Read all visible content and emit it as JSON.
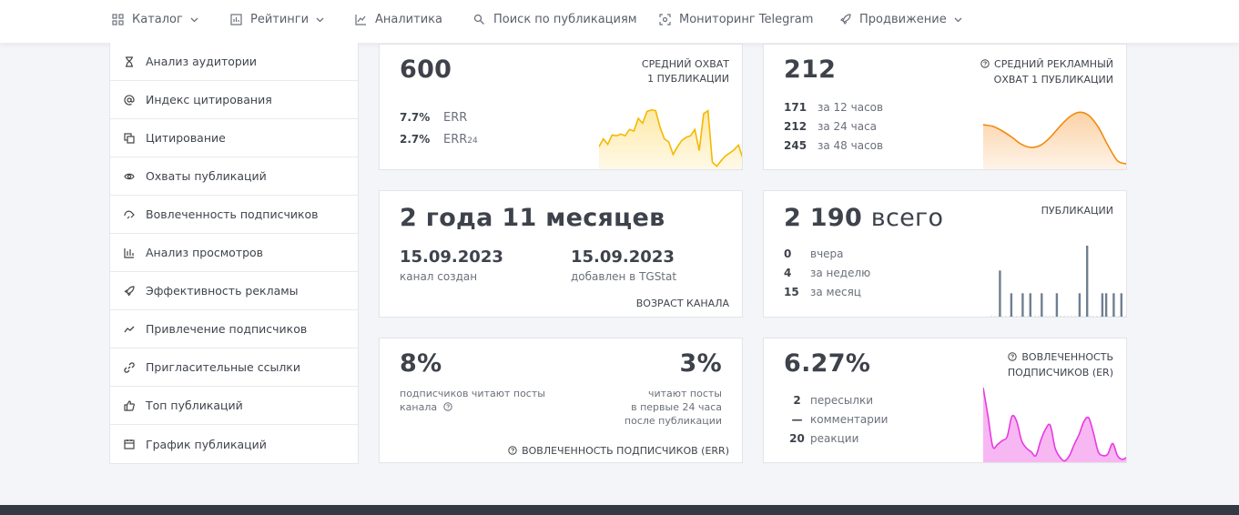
{
  "nav": {
    "items": [
      {
        "label": "Каталог",
        "has_dropdown": true,
        "icon": "grid-icon"
      },
      {
        "label": "Рейтинги",
        "has_dropdown": true,
        "icon": "ratings-icon"
      },
      {
        "label": "Аналитика",
        "has_dropdown": false,
        "icon": "chart-line-icon"
      },
      {
        "label": "Поиск по публикациям",
        "has_dropdown": false,
        "icon": "search-icon"
      },
      {
        "label": "Мониторинг Telegram",
        "has_dropdown": false,
        "icon": "monitor-icon"
      },
      {
        "label": "Продвижение",
        "has_dropdown": true,
        "icon": "rocket-icon"
      }
    ]
  },
  "sidebar": {
    "items": [
      {
        "label": "Анализ аудитории",
        "icon": "hourglass-icon"
      },
      {
        "label": "Индекс цитирования",
        "icon": "at-icon"
      },
      {
        "label": "Цитирование",
        "icon": "copy-icon"
      },
      {
        "label": "Охваты публикаций",
        "icon": "eye-icon"
      },
      {
        "label": "Вовлеченность подписчиков",
        "icon": "engagement-icon"
      },
      {
        "label": "Анализ просмотров",
        "icon": "bar-chart-icon"
      },
      {
        "label": "Эффективность рекламы",
        "icon": "rocket-icon"
      },
      {
        "label": "Привлечение подписчиков",
        "icon": "trend-icon"
      },
      {
        "label": "Пригласительные ссылки",
        "icon": "link-icon"
      },
      {
        "label": "Топ публикаций",
        "icon": "thumbs-up-icon"
      },
      {
        "label": "График публикаций",
        "icon": "calendar-icon"
      }
    ]
  },
  "reach": {
    "value": "600",
    "caption_line1": "СРЕДНИЙ ОХВАТ",
    "caption_line2": "1 ПУБЛИКАЦИИ",
    "err_value": "7.7%",
    "err_label": "ERR",
    "err24_value": "2.7%",
    "err24_label": "ERR",
    "err24_sub": "24"
  },
  "ad_reach": {
    "value": "212",
    "caption_line1": "СРЕДНИЙ РЕКЛАМНЫЙ",
    "caption_line2": "ОХВАТ 1 ПУБЛИКАЦИИ",
    "rows": [
      {
        "value": "171",
        "label": "за 12 часов"
      },
      {
        "value": "212",
        "label": "за 24 часа"
      },
      {
        "value": "245",
        "label": "за 48 часов"
      }
    ]
  },
  "age": {
    "value": "2 года 11 месяцев",
    "created_date": "15.09.2023",
    "created_label": "канал создан",
    "added_date": "15.09.2023",
    "added_label": "добавлен в TGStat",
    "caption": "ВОЗРАСТ КАНАЛА"
  },
  "posts": {
    "value": "2 190",
    "value_suffix": "всего",
    "caption": "ПУБЛИКАЦИИ",
    "rows": [
      {
        "value": "0",
        "label": "вчера"
      },
      {
        "value": "4",
        "label": "за неделю"
      },
      {
        "value": "15",
        "label": "за месяц"
      }
    ]
  },
  "err": {
    "left_value": "8%",
    "left_desc_line1": "подписчиков читают посты",
    "left_desc_line2": "канала",
    "right_value": "3%",
    "right_desc_line1": "читают посты",
    "right_desc_line2": "в первые 24 часа",
    "right_desc_line3": "после публикации",
    "caption": "ВОВЛЕЧЕННОСТЬ ПОДПИСЧИКОВ (ERR)"
  },
  "er": {
    "value": "6.27%",
    "caption_line1": "ВОВЛЕЧЕННОСТЬ",
    "caption_line2": "ПОДПИСЧИКОВ (ER)",
    "rows": [
      {
        "value": "2",
        "label": "пересылки"
      },
      {
        "value": "—",
        "label": "комментарии"
      },
      {
        "value": "20",
        "label": "реакции"
      }
    ]
  },
  "colors": {
    "reach_line": "#f5b800",
    "reach_fill": "#fde9a6",
    "ad_line": "#f28a0e",
    "ad_fill": "#fbd2a6",
    "posts_bar": "#6f7f8f",
    "er_line": "#e83ae0",
    "er_fill": "#f7b7f2"
  },
  "chart_data": [
    {
      "type": "area",
      "name_ref": "reach-sparkline",
      "values": [
        0.3,
        0.4,
        0.33,
        0.45,
        0.44,
        0.46,
        0.44,
        0.52,
        0.5,
        0.66,
        0.6,
        0.75,
        0.77,
        0.76,
        0.55,
        0.4,
        0.36,
        0.2,
        0.3,
        0.38,
        0.42,
        0.44,
        0.52,
        0.25,
        0.72,
        0.76,
        0.1,
        0.05,
        0.12,
        0.18,
        0.22,
        0.26,
        0.32,
        0.15
      ],
      "ylim": [
        0,
        1
      ]
    },
    {
      "type": "area",
      "name_ref": "ad-reach-sparkline",
      "values": [
        0.58,
        0.56,
        0.5,
        0.42,
        0.33,
        0.29,
        0.32,
        0.42,
        0.56,
        0.68,
        0.74,
        0.7,
        0.55,
        0.32,
        0.12,
        0.08
      ],
      "ylim": [
        0,
        1
      ]
    },
    {
      "type": "bar",
      "name_ref": "posts-bars",
      "values": [
        0,
        0,
        0.65,
        0,
        0,
        0.33,
        0,
        0,
        0.33,
        0,
        0.33,
        0,
        0,
        0.33,
        0,
        0,
        0,
        0.33,
        0,
        0,
        0,
        0,
        0,
        0.33,
        0,
        1.0,
        0,
        0,
        0,
        0.33,
        0.33,
        0,
        0.33,
        0,
        0.33,
        0
      ],
      "ylim": [
        0,
        1
      ]
    },
    {
      "type": "area",
      "name_ref": "er-sparkline",
      "values": [
        1.0,
        0.62,
        0.22,
        0.25,
        0.3,
        0.35,
        0.62,
        0.55,
        0.3,
        0.2,
        0.15,
        0.1,
        0.3,
        0.45,
        0.5,
        0.2,
        0.08,
        0.03,
        0.1,
        0.25,
        0.38,
        0.55,
        0.6,
        0.4,
        0.15,
        0.1,
        0.12,
        0.26,
        0.1,
        0.05,
        0.08
      ],
      "ylim": [
        0,
        1
      ]
    }
  ]
}
